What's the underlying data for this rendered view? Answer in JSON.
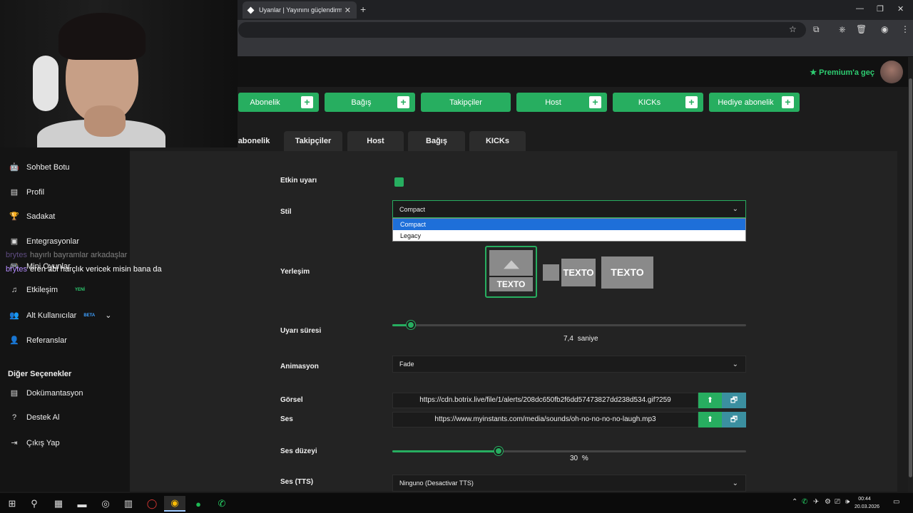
{
  "browser": {
    "tab_title": "Uyanlar | Yayınını güçlendirmek",
    "tab_close": "✕",
    "new_tab": "+",
    "win_min": "—",
    "win_max": "❐",
    "win_close": "✕"
  },
  "header": {
    "premium_label": "Premium'a geç",
    "premium_star": "★"
  },
  "alert_buttons": [
    "Abonelik",
    "Bağış",
    "Takipçiler",
    "Host",
    "KICKs",
    "Hediye abonelik"
  ],
  "alert_plus": "+",
  "tabs": [
    "abonelik",
    "Takipçiler",
    "Host",
    "Bağış",
    "KICKs"
  ],
  "sidebar": {
    "items": [
      {
        "label": "Sohbet Botu",
        "icon": "🤖"
      },
      {
        "label": "Profil",
        "icon": "▤"
      },
      {
        "label": "Sadakat",
        "icon": "🏆"
      },
      {
        "label": "Entegrasyonlar",
        "icon": "▣"
      },
      {
        "label": "Mini Oyunlar",
        "icon": "🎮"
      },
      {
        "label": "Etkileşim",
        "icon": "♫"
      },
      {
        "label": "Alt Kullanıcılar",
        "icon": "👥"
      },
      {
        "label": "Referanslar",
        "icon": "👤"
      }
    ],
    "badge_new": "YENİ",
    "badge_beta": "BETA",
    "chevron": "⌄",
    "section_title": "Diğer Seçenekler",
    "other_items": [
      {
        "label": "Dokümantasyon",
        "icon": "▤"
      },
      {
        "label": "Destek Al",
        "icon": "?"
      },
      {
        "label": "Çıkış Yap",
        "icon": "⇥"
      }
    ]
  },
  "chat": [
    {
      "user": "brytes",
      "message": "hayırlı bayramlar arkadaşlar"
    },
    {
      "user": "brytes",
      "message": "eren abi harçlık vericek misin bana da"
    }
  ],
  "form": {
    "active_label": "Etkin uyarı",
    "style_label": "Stil",
    "style_value": "Compact",
    "style_options": [
      "Compact",
      "Legacy"
    ],
    "layout_label": "Yerleşim",
    "layout_text": "TEXTO",
    "duration_label": "Uyarı süresi",
    "duration_value": "7,4",
    "duration_unit": "saniye",
    "duration_fraction": 0.053,
    "animation_label": "Animasyon",
    "animation_value": "Fade",
    "visual_label": "Görsel",
    "visual_url": "https://cdn.botrix.live/file/1/alerts/208dc650fb2f6dd57473827dd238d534.gif?259",
    "sound_label": "Ses",
    "sound_url": "https://www.myinstants.com/media/sounds/oh-no-no-no-no-laugh.mp3",
    "volume_label": "Ses düzeyi",
    "volume_value": "30",
    "volume_unit": "%",
    "volume_fraction": 0.3,
    "tts_label": "Ses (TTS)",
    "tts_value": "Ninguno (Desactivar TTS)",
    "chevron": "⌄",
    "upload_icon": "⬆",
    "gallery_icon": "🗗"
  },
  "taskbar": {
    "time": "00:44",
    "date": "20.03.2026"
  },
  "colors": {
    "accent": "#27ae60",
    "dropdown_selected": "#1e6fd9"
  }
}
